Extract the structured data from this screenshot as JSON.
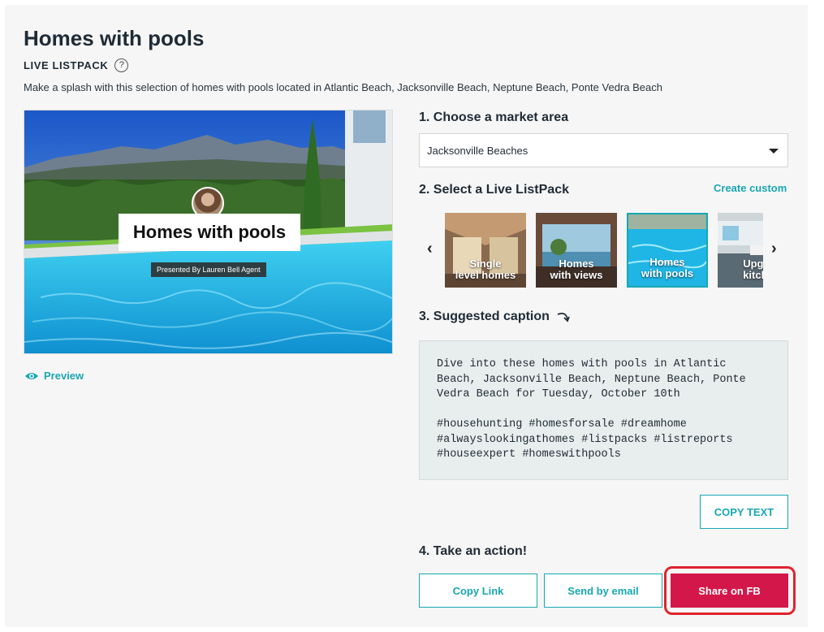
{
  "header": {
    "title": "Homes with pools",
    "subtitle": "LIVE LISTPACK",
    "help_symbol": "?",
    "description": "Make a splash with this selection of homes with pools located in Atlantic Beach, Jacksonville Beach, Neptune Beach, Ponte Vedra Beach"
  },
  "preview": {
    "image_title": "Homes with pools",
    "presenter": "Presented By Lauren Bell Agent",
    "link_label": "Preview"
  },
  "steps": {
    "market": {
      "label": "1. Choose a market area",
      "selected": "Jacksonville Beaches"
    },
    "listpack": {
      "label": "2. Select a Live ListPack",
      "create_custom": "Create custom",
      "prev_symbol": "‹",
      "next_symbol": "›",
      "cards": [
        {
          "line1": "Single",
          "line2": "level homes",
          "selected": false
        },
        {
          "line1": "Homes",
          "line2": "with views",
          "selected": false
        },
        {
          "line1": "Homes",
          "line2": "with pools",
          "selected": true
        },
        {
          "line1": "Upgra",
          "line2": "kitche",
          "selected": false
        }
      ]
    },
    "caption": {
      "label": "3. Suggested caption",
      "text": "Dive into these homes with pools in Atlantic\nBeach, Jacksonville Beach, Neptune Beach, Ponte\nVedra Beach for Tuesday, October 10th\n\n#househunting #homesforsale #dreamhome\n#alwayslookingathomes #listpacks #listreports\n#houseexpert #homeswithpools",
      "copy_button": "COPY TEXT"
    },
    "action": {
      "label": "4. Take an action!",
      "copy_link": "Copy Link",
      "send_email": "Send by email",
      "share_fb": "Share on FB"
    }
  },
  "colors": {
    "accent": "#19a7b1",
    "primary": "#d4174a",
    "highlight": "#e0242e"
  }
}
